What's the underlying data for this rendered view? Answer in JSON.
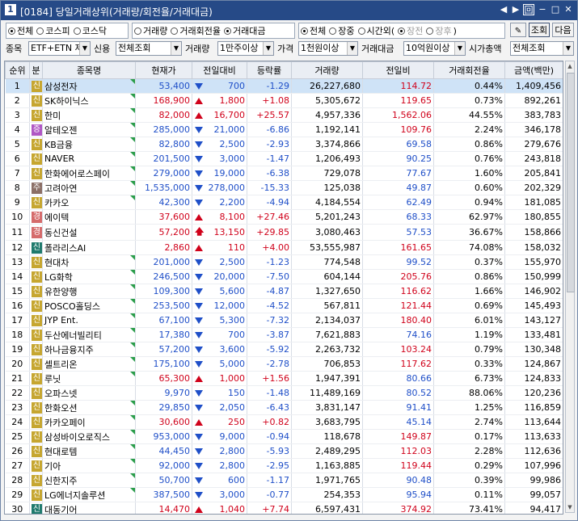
{
  "window": {
    "badge": "1",
    "title": "[0184] 당일거래상위(거래량/회전율/거래대금)",
    "buttons": [
      "◀",
      "▶",
      "回",
      "−",
      "□",
      "✕"
    ]
  },
  "filters": {
    "market": [
      {
        "label": "전체",
        "on": true
      },
      {
        "label": "코스피",
        "on": false
      },
      {
        "label": "코스닥",
        "on": false
      }
    ],
    "sort": [
      {
        "label": "거래량",
        "on": false
      },
      {
        "label": "거래회전율",
        "on": false
      },
      {
        "label": "거래대금",
        "on": true
      }
    ],
    "session": [
      {
        "label": "전체",
        "on": true
      },
      {
        "label": "장중",
        "on": false
      },
      {
        "label": "시간외(",
        "on": false
      }
    ],
    "session_sub": [
      {
        "label": "장전",
        "on": true
      },
      {
        "label": "장후",
        "on": false
      }
    ],
    "session_close": ")",
    "query_button": "조회",
    "next_button": "다음"
  },
  "conditions": {
    "item_label": "종목",
    "item_value": "ETF+ETN 제",
    "credit_label": "신용",
    "credit_value": "전체조회",
    "volume_label": "거래량",
    "volume_value": "1만주이상",
    "price_label": "가격",
    "price_value": "1천원이상",
    "amount_label": "거래대금",
    "amount_value": "10억원이상",
    "mcap_label": "시가총액",
    "mcap_value": "전체조회"
  },
  "table": {
    "headers": [
      "순위",
      "분",
      "종목명",
      "현재가",
      "전일대비",
      "등락률",
      "거래량",
      "전일비",
      "거래회전율",
      "금액(백만)"
    ],
    "rows": [
      {
        "rank": "1",
        "badge": "신",
        "badge_color": "#c6a630",
        "name": "삼성전자",
        "price": "53,400",
        "dir": "dn",
        "diff": "700",
        "rate": "-1.29",
        "volume": "26,227,680",
        "prev": "114.72",
        "prev_dir": "up",
        "turnover": "0.44%",
        "amount": "1,409,456",
        "flag": true
      },
      {
        "rank": "2",
        "badge": "신",
        "badge_color": "#c6a630",
        "name": "SK하이닉스",
        "price": "168,900",
        "dir": "up",
        "diff": "1,800",
        "rate": "+1.08",
        "volume": "5,305,672",
        "prev": "119.65",
        "prev_dir": "up",
        "turnover": "0.73%",
        "amount": "892,261",
        "flag": true
      },
      {
        "rank": "3",
        "badge": "신",
        "badge_color": "#c6a630",
        "name": "한미",
        "price": "82,000",
        "dir": "up",
        "diff": "16,700",
        "rate": "+25.57",
        "volume": "4,957,336",
        "prev": "1,562.06",
        "prev_dir": "up",
        "turnover": "44.55%",
        "amount": "383,783",
        "flag": true
      },
      {
        "rank": "4",
        "badge": "증",
        "badge_color": "#b057c4",
        "name": "알테오젠",
        "price": "285,000",
        "dir": "dn",
        "diff": "21,000",
        "rate": "-6.86",
        "volume": "1,192,141",
        "prev": "109.76",
        "prev_dir": "up",
        "turnover": "2.24%",
        "amount": "346,178",
        "flag": true
      },
      {
        "rank": "5",
        "badge": "신",
        "badge_color": "#c6a630",
        "name": "KB금융",
        "price": "82,800",
        "dir": "dn",
        "diff": "2,500",
        "rate": "-2.93",
        "volume": "3,374,866",
        "prev": "69.58",
        "prev_dir": "dn",
        "turnover": "0.86%",
        "amount": "279,676",
        "flag": true
      },
      {
        "rank": "6",
        "badge": "신",
        "badge_color": "#c6a630",
        "name": "NAVER",
        "price": "201,500",
        "dir": "dn",
        "diff": "3,000",
        "rate": "-1.47",
        "volume": "1,206,493",
        "prev": "90.25",
        "prev_dir": "dn",
        "turnover": "0.76%",
        "amount": "243,818",
        "flag": true
      },
      {
        "rank": "7",
        "badge": "신",
        "badge_color": "#c6a630",
        "name": "한화에어로스페이",
        "price": "279,000",
        "dir": "dn",
        "diff": "19,000",
        "rate": "-6.38",
        "volume": "729,078",
        "prev": "77.67",
        "prev_dir": "dn",
        "turnover": "1.60%",
        "amount": "205,841",
        "flag": true
      },
      {
        "rank": "8",
        "badge": "주",
        "badge_color": "#8b6f66",
        "name": "고려아연",
        "price": "1,535,000",
        "dir": "dn",
        "diff": "278,000",
        "rate": "-15.33",
        "volume": "125,038",
        "prev": "49.87",
        "prev_dir": "dn",
        "turnover": "0.60%",
        "amount": "202,329",
        "flag": true
      },
      {
        "rank": "9",
        "badge": "신",
        "badge_color": "#c6a630",
        "name": "카카오",
        "price": "42,300",
        "dir": "dn",
        "diff": "2,200",
        "rate": "-4.94",
        "volume": "4,184,554",
        "prev": "62.49",
        "prev_dir": "dn",
        "turnover": "0.94%",
        "amount": "181,085",
        "flag": true
      },
      {
        "rank": "10",
        "badge": "경",
        "badge_color": "#d56b6b",
        "name": "에이텍",
        "price": "37,600",
        "dir": "up",
        "diff": "8,100",
        "rate": "+27.46",
        "volume": "5,201,243",
        "prev": "68.33",
        "prev_dir": "dn",
        "turnover": "62.97%",
        "amount": "180,855",
        "flag": false
      },
      {
        "rank": "11",
        "badge": "경",
        "badge_color": "#d56b6b",
        "name": "동신건설",
        "price": "57,200",
        "dir": "up",
        "diff": "13,150",
        "rate": "+29.85",
        "volume": "3,080,463",
        "prev": "57.53",
        "prev_dir": "dn",
        "turnover": "36.67%",
        "amount": "158,866",
        "flag": false,
        "limit": true
      },
      {
        "rank": "12",
        "badge": "신",
        "badge_color": "#1f7a6d",
        "name": "폴라리스AI",
        "price": "2,860",
        "dir": "up",
        "diff": "110",
        "rate": "+4.00",
        "volume": "53,555,987",
        "prev": "161.65",
        "prev_dir": "up",
        "turnover": "74.08%",
        "amount": "158,032",
        "flag": false
      },
      {
        "rank": "13",
        "badge": "신",
        "badge_color": "#c6a630",
        "name": "현대차",
        "price": "201,000",
        "dir": "dn",
        "diff": "2,500",
        "rate": "-1.23",
        "volume": "774,548",
        "prev": "99.52",
        "prev_dir": "dn",
        "turnover": "0.37%",
        "amount": "155,970",
        "flag": true
      },
      {
        "rank": "14",
        "badge": "신",
        "badge_color": "#c6a630",
        "name": "LG화학",
        "price": "246,500",
        "dir": "dn",
        "diff": "20,000",
        "rate": "-7.50",
        "volume": "604,144",
        "prev": "205.76",
        "prev_dir": "up",
        "turnover": "0.86%",
        "amount": "150,999",
        "flag": true
      },
      {
        "rank": "15",
        "badge": "신",
        "badge_color": "#c6a630",
        "name": "유한양행",
        "price": "109,300",
        "dir": "dn",
        "diff": "5,600",
        "rate": "-4.87",
        "volume": "1,327,650",
        "prev": "116.62",
        "prev_dir": "up",
        "turnover": "1.66%",
        "amount": "146,902",
        "flag": true
      },
      {
        "rank": "16",
        "badge": "신",
        "badge_color": "#c6a630",
        "name": "POSCO홀딩스",
        "price": "253,500",
        "dir": "dn",
        "diff": "12,000",
        "rate": "-4.52",
        "volume": "567,811",
        "prev": "121.44",
        "prev_dir": "up",
        "turnover": "0.69%",
        "amount": "145,493",
        "flag": true
      },
      {
        "rank": "17",
        "badge": "신",
        "badge_color": "#c6a630",
        "name": "JYP Ent.",
        "price": "67,100",
        "dir": "dn",
        "diff": "5,300",
        "rate": "-7.32",
        "volume": "2,134,037",
        "prev": "180.40",
        "prev_dir": "up",
        "turnover": "6.01%",
        "amount": "143,127",
        "flag": true
      },
      {
        "rank": "18",
        "badge": "신",
        "badge_color": "#c6a630",
        "name": "두산에너빌리티",
        "price": "17,380",
        "dir": "dn",
        "diff": "700",
        "rate": "-3.87",
        "volume": "7,621,883",
        "prev": "74.16",
        "prev_dir": "dn",
        "turnover": "1.19%",
        "amount": "133,481",
        "flag": true
      },
      {
        "rank": "19",
        "badge": "신",
        "badge_color": "#c6a630",
        "name": "하나금융지주",
        "price": "57,200",
        "dir": "dn",
        "diff": "3,600",
        "rate": "-5.92",
        "volume": "2,263,732",
        "prev": "103.24",
        "prev_dir": "up",
        "turnover": "0.79%",
        "amount": "130,348",
        "flag": true
      },
      {
        "rank": "20",
        "badge": "신",
        "badge_color": "#c6a630",
        "name": "셀트리온",
        "price": "175,100",
        "dir": "dn",
        "diff": "5,000",
        "rate": "-2.78",
        "volume": "706,853",
        "prev": "117.62",
        "prev_dir": "up",
        "turnover": "0.33%",
        "amount": "124,867",
        "flag": true
      },
      {
        "rank": "21",
        "badge": "신",
        "badge_color": "#c6a630",
        "name": "루닛",
        "price": "65,300",
        "dir": "up",
        "diff": "1,000",
        "rate": "+1.56",
        "volume": "1,947,391",
        "prev": "80.66",
        "prev_dir": "dn",
        "turnover": "6.73%",
        "amount": "124,833",
        "flag": true
      },
      {
        "rank": "22",
        "badge": "신",
        "badge_color": "#c6a630",
        "name": "오파스넷",
        "price": "9,970",
        "dir": "dn",
        "diff": "150",
        "rate": "-1.48",
        "volume": "11,489,169",
        "prev": "80.52",
        "prev_dir": "dn",
        "turnover": "88.06%",
        "amount": "120,236",
        "flag": false
      },
      {
        "rank": "23",
        "badge": "신",
        "badge_color": "#c6a630",
        "name": "한화오션",
        "price": "29,850",
        "dir": "dn",
        "diff": "2,050",
        "rate": "-6.43",
        "volume": "3,831,147",
        "prev": "91.41",
        "prev_dir": "dn",
        "turnover": "1.25%",
        "amount": "116,859",
        "flag": true
      },
      {
        "rank": "24",
        "badge": "신",
        "badge_color": "#c6a630",
        "name": "카카오페이",
        "price": "30,600",
        "dir": "up",
        "diff": "250",
        "rate": "+0.82",
        "volume": "3,683,795",
        "prev": "45.14",
        "prev_dir": "dn",
        "turnover": "2.74%",
        "amount": "113,644",
        "flag": true
      },
      {
        "rank": "25",
        "badge": "신",
        "badge_color": "#c6a630",
        "name": "삼성바이오로직스",
        "price": "953,000",
        "dir": "dn",
        "diff": "9,000",
        "rate": "-0.94",
        "volume": "118,678",
        "prev": "149.87",
        "prev_dir": "up",
        "turnover": "0.17%",
        "amount": "113,633",
        "flag": true
      },
      {
        "rank": "26",
        "badge": "신",
        "badge_color": "#c6a630",
        "name": "현대로템",
        "price": "44,450",
        "dir": "dn",
        "diff": "2,800",
        "rate": "-5.93",
        "volume": "2,489,295",
        "prev": "112.03",
        "prev_dir": "up",
        "turnover": "2.28%",
        "amount": "112,636",
        "flag": true
      },
      {
        "rank": "27",
        "badge": "신",
        "badge_color": "#c6a630",
        "name": "기아",
        "price": "92,000",
        "dir": "dn",
        "diff": "2,800",
        "rate": "-2.95",
        "volume": "1,163,885",
        "prev": "119.44",
        "prev_dir": "up",
        "turnover": "0.29%",
        "amount": "107,996",
        "flag": true
      },
      {
        "rank": "28",
        "badge": "신",
        "badge_color": "#c6a630",
        "name": "신한지주",
        "price": "50,700",
        "dir": "dn",
        "diff": "600",
        "rate": "-1.17",
        "volume": "1,971,765",
        "prev": "90.48",
        "prev_dir": "dn",
        "turnover": "0.39%",
        "amount": "99,986",
        "flag": true
      },
      {
        "rank": "29",
        "badge": "신",
        "badge_color": "#c6a630",
        "name": "LG에너지솔루션",
        "price": "387,500",
        "dir": "dn",
        "diff": "3,000",
        "rate": "-0.77",
        "volume": "254,353",
        "prev": "95.94",
        "prev_dir": "dn",
        "turnover": "0.11%",
        "amount": "99,057",
        "flag": true
      },
      {
        "rank": "30",
        "badge": "신",
        "badge_color": "#1f7a6d",
        "name": "대동기어",
        "price": "14,470",
        "dir": "up",
        "diff": "1,040",
        "rate": "+7.74",
        "volume": "6,597,431",
        "prev": "374.92",
        "prev_dir": "up",
        "turnover": "73.41%",
        "amount": "94,417",
        "flag": false
      }
    ]
  }
}
